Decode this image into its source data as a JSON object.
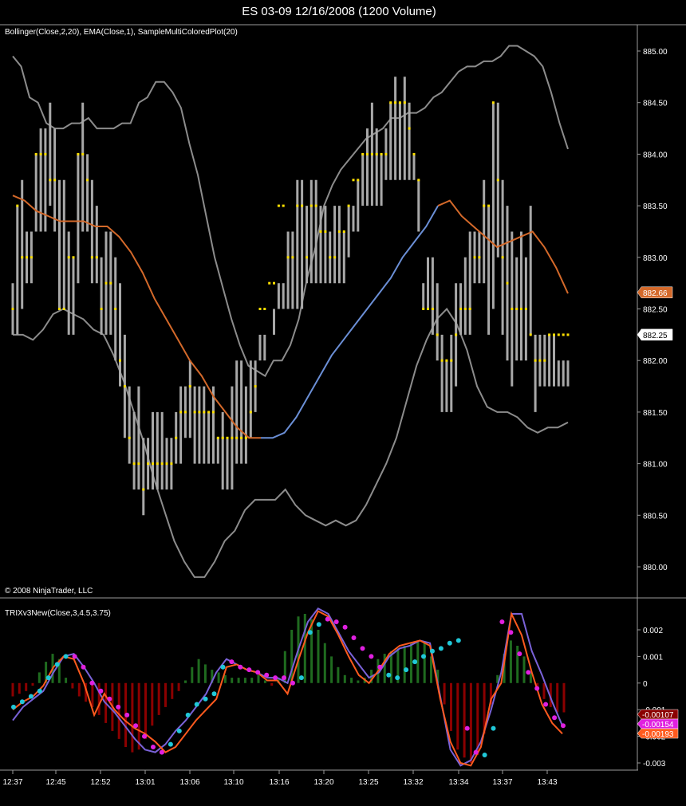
{
  "window": {
    "title": "ES 03-09  12/16/2008 (1200 Volume)"
  },
  "price_panel": {
    "indicator_label": "Bollinger(Close,2,20), EMA(Close,1), SampleMultiColoredPlot(20)",
    "copyright": "© 2008 NinjaTrader, LLC",
    "y_ticks": [
      "885.00",
      "884.50",
      "884.00",
      "883.50",
      "883.00",
      "882.50",
      "882.00",
      "881.50",
      "881.00",
      "880.50",
      "880.00"
    ],
    "last_markers": [
      {
        "text": "882.66",
        "color": "#d4692a",
        "text_color": "#ffffff"
      },
      {
        "text": "882.25",
        "color": "#ffffff",
        "text_color": "#000000"
      }
    ]
  },
  "trix_panel": {
    "indicator_label": "TRIXv3New(Close,3,4.5,3.75)",
    "y_ticks": [
      "0.002",
      "0.001",
      "0",
      "-0.001",
      "-0.002",
      "-0.003"
    ],
    "markers": [
      {
        "text": "-0.00107",
        "color": "#8b0000",
        "text_color": "#ffffff"
      },
      {
        "text": "-0.00154",
        "color": "#e020e0",
        "text_color": "#ffffff"
      },
      {
        "text": "-0.00193",
        "color": "#ff5a1e",
        "text_color": "#ffffff"
      }
    ]
  },
  "x_ticks": [
    "12:37",
    "12:45",
    "12:52",
    "13:01",
    "13:06",
    "13:10",
    "13:16",
    "13:20",
    "13:25",
    "13:32",
    "13:34",
    "13:37",
    "13:43"
  ],
  "colors": {
    "bar": "#a8a8a8",
    "close_tick": "#ffe000",
    "bollinger": "#8c8c8c",
    "ema_down": "#d4692a",
    "ema_up": "#6b8fd6",
    "hist_pos": "#1f6b1f",
    "hist_neg": "#8b0000",
    "trix_line": "#7a62d8",
    "signal_line": "#ff5a1e",
    "dot_up": "#20c8d8",
    "dot_down": "#e020e0"
  },
  "chart_data": [
    {
      "type": "bar",
      "name": "OHLC range bars",
      "x_index": [
        0,
        1,
        2,
        3,
        4,
        5,
        6,
        7,
        8,
        9,
        10,
        11,
        12,
        13,
        14,
        15,
        16,
        17,
        18,
        19,
        20,
        21,
        22,
        23,
        24,
        25,
        26,
        27,
        28,
        29,
        30,
        31,
        32,
        33,
        34,
        35,
        36,
        37,
        38,
        39,
        40,
        41,
        42,
        43,
        44,
        45,
        46,
        47,
        48,
        49,
        50,
        51,
        52,
        53,
        54,
        55,
        56,
        57,
        58,
        59,
        60,
        61,
        62,
        63,
        64,
        65,
        66,
        67,
        68,
        69,
        70,
        71,
        72,
        73,
        74,
        75,
        76,
        77,
        78,
        79,
        80,
        81,
        82,
        83,
        84,
        85,
        86,
        87,
        88,
        89,
        90,
        91,
        92,
        93,
        94,
        95,
        96,
        97,
        98,
        99,
        100,
        101,
        102,
        103,
        104,
        105,
        106,
        107,
        108,
        109,
        110,
        111,
        112,
        113,
        114,
        115,
        116,
        117,
        118,
        119
      ],
      "high": [
        882.75,
        883.5,
        883.75,
        883.25,
        883.25,
        884.0,
        884.25,
        884.25,
        884.5,
        884.25,
        883.75,
        883.75,
        883.25,
        883.0,
        884.0,
        884.5,
        884.0,
        883.75,
        883.5,
        883.0,
        883.25,
        883.25,
        883.0,
        882.75,
        882.25,
        881.75,
        881.5,
        881.75,
        881.25,
        881.25,
        881.5,
        881.5,
        881.5,
        881.25,
        881.25,
        881.5,
        881.75,
        881.75,
        882.0,
        881.75,
        881.75,
        881.75,
        881.5,
        881.75,
        881.25,
        881.5,
        881.25,
        881.75,
        882.0,
        882.0,
        881.75,
        882.0,
        882.0,
        882.0,
        882.0,
        882.25,
        882.25,
        882.75,
        882.75,
        883.25,
        883.25,
        883.75,
        883.75,
        883.5,
        883.75,
        883.75,
        883.5,
        883.5,
        883.25,
        883.5,
        883.5,
        883.25,
        883.5,
        883.25,
        883.75,
        884.0,
        884.25,
        884.5,
        884.25,
        884.0,
        884.25,
        884.5,
        884.75,
        884.5,
        884.75,
        884.5,
        884.0,
        883.75,
        882.75,
        883.0,
        883.0,
        882.75,
        882.25,
        882.0,
        882.25,
        882.75,
        882.75,
        883.0,
        883.25,
        883.25,
        883.25,
        883.75,
        883.5,
        884.5,
        884.5,
        883.75,
        883.5,
        883.25,
        883.0,
        883.25,
        883.0,
        883.5,
        882.25,
        882.25,
        882.25,
        882.25,
        882.25,
        882.0,
        882.0,
        882.0
      ],
      "low": [
        882.25,
        882.25,
        882.5,
        882.75,
        882.75,
        883.25,
        883.25,
        883.25,
        883.5,
        883.25,
        882.5,
        882.5,
        882.25,
        882.25,
        882.75,
        883.25,
        883.25,
        882.75,
        882.75,
        882.25,
        882.25,
        882.25,
        882.0,
        881.75,
        881.25,
        881.0,
        880.75,
        880.75,
        880.5,
        880.75,
        880.75,
        880.75,
        880.75,
        880.75,
        880.75,
        881.0,
        881.0,
        881.25,
        881.25,
        881.0,
        881.0,
        881.0,
        881.0,
        881.0,
        881.0,
        880.75,
        880.75,
        880.75,
        881.0,
        881.0,
        881.0,
        881.25,
        881.5,
        882.25,
        882.25,
        882.25,
        882.5,
        882.5,
        882.5,
        882.5,
        882.5,
        882.5,
        882.5,
        882.75,
        882.75,
        882.75,
        882.75,
        882.75,
        882.75,
        882.75,
        882.75,
        882.75,
        883.0,
        883.5,
        883.25,
        883.5,
        883.5,
        883.5,
        883.5,
        883.5,
        883.75,
        883.75,
        883.75,
        883.75,
        883.75,
        883.75,
        883.75,
        883.25,
        882.5,
        882.5,
        882.25,
        882.0,
        881.5,
        881.5,
        881.5,
        881.75,
        882.25,
        882.25,
        882.25,
        882.75,
        882.75,
        882.75,
        882.25,
        882.5,
        883.0,
        882.25,
        882.0,
        881.75,
        882.0,
        882.0,
        882.0,
        882.25,
        881.5,
        881.75,
        881.75,
        881.75,
        881.75,
        881.75,
        881.75,
        881.75
      ],
      "close": [
        882.5,
        883.5,
        883.0,
        883.0,
        883.0,
        884.0,
        884.0,
        884.0,
        883.75,
        883.75,
        882.5,
        882.5,
        883.0,
        883.0,
        884.0,
        884.0,
        883.75,
        883.0,
        883.0,
        882.5,
        882.75,
        882.75,
        882.5,
        882.0,
        881.75,
        881.25,
        881.0,
        881.0,
        880.75,
        881.0,
        881.0,
        881.0,
        881.0,
        881.0,
        881.0,
        881.25,
        881.5,
        881.5,
        881.75,
        881.5,
        881.5,
        881.5,
        881.5,
        881.5,
        881.25,
        881.25,
        881.25,
        881.25,
        881.25,
        881.25,
        881.25,
        881.5,
        881.75,
        882.5,
        882.5,
        882.75,
        882.75,
        883.5,
        883.5,
        883.0,
        883.0,
        883.5,
        883.5,
        883.0,
        883.5,
        883.5,
        883.25,
        883.25,
        883.0,
        883.0,
        883.25,
        883.25,
        883.5,
        883.75,
        883.75,
        884.0,
        884.0,
        884.0,
        884.0,
        884.0,
        884.0,
        884.5,
        884.5,
        884.5,
        884.5,
        884.25,
        884.0,
        883.75,
        882.5,
        882.5,
        882.5,
        882.25,
        882.0,
        882.0,
        882.0,
        882.25,
        882.5,
        882.5,
        882.5,
        883.0,
        883.0,
        883.5,
        883.5,
        884.5,
        883.75,
        883.0,
        882.75,
        882.5,
        882.5,
        882.5,
        882.5,
        882.25,
        882.0,
        882.0,
        882.0,
        882.25,
        882.25,
        882.25,
        882.25,
        882.25
      ]
    },
    {
      "type": "line",
      "name": "Bollinger Upper",
      "y": [
        884.95,
        884.85,
        884.55,
        884.5,
        884.3,
        884.25,
        884.25,
        884.3,
        884.3,
        884.35,
        884.25,
        884.25,
        884.25,
        884.3,
        884.3,
        884.5,
        884.55,
        884.7,
        884.7,
        884.6,
        884.45,
        884.1,
        883.8,
        883.4,
        883.0,
        882.7,
        882.4,
        882.15,
        881.95,
        881.9,
        881.85,
        882.0,
        882.0,
        882.15,
        882.4,
        882.8,
        883.1,
        883.5,
        883.7,
        883.85,
        883.95,
        884.05,
        884.15,
        884.2,
        884.25,
        884.35,
        884.35,
        884.4,
        884.4,
        884.45,
        884.55,
        884.6,
        884.7,
        884.8,
        884.85,
        884.85,
        884.9,
        884.9,
        884.95,
        885.05,
        885.05,
        885.0,
        884.95,
        884.85,
        884.6,
        884.3,
        884.05
      ],
      "x_step": 1.78
    },
    {
      "type": "line",
      "name": "Bollinger Lower",
      "y": [
        882.25,
        882.25,
        882.2,
        882.3,
        882.45,
        882.5,
        882.45,
        882.4,
        882.3,
        882.25,
        882.05,
        881.8,
        881.5,
        881.2,
        880.85,
        880.55,
        880.25,
        880.05,
        879.9,
        879.9,
        880.05,
        880.25,
        880.35,
        880.55,
        880.65,
        880.65,
        880.65,
        880.75,
        880.6,
        880.5,
        880.45,
        880.4,
        880.45,
        880.4,
        880.45,
        880.6,
        880.8,
        881.0,
        881.25,
        881.6,
        881.95,
        882.2,
        882.4,
        882.5,
        882.35,
        882.1,
        881.75,
        881.55,
        881.5,
        881.5,
        881.45,
        881.35,
        881.3,
        881.35,
        881.35,
        881.4
      ],
      "x_step": 2.14
    },
    {
      "type": "line",
      "name": "EMA (colored)",
      "y": [
        883.6,
        883.55,
        883.45,
        883.4,
        883.35,
        883.35,
        883.35,
        883.3,
        883.3,
        883.2,
        883.05,
        882.85,
        882.6,
        882.4,
        882.2,
        882.0,
        881.85,
        881.65,
        881.5,
        881.35,
        881.25,
        881.25,
        881.25,
        881.3,
        881.45,
        881.65,
        881.85,
        882.05,
        882.2,
        882.35,
        882.5,
        882.65,
        882.8,
        883.0,
        883.15,
        883.3,
        883.5,
        883.55,
        883.4,
        883.3,
        883.2,
        883.1,
        883.15,
        883.2,
        883.25,
        883.1,
        882.9,
        882.65
      ],
      "x_step": 2.5,
      "turning_index": 21
    },
    {
      "type": "bar",
      "name": "TRIX histogram",
      "values": [
        -0.0005,
        -0.0004,
        -0.0003,
        -0.0001,
        0.0004,
        0.0008,
        0.0011,
        0.0009,
        0.0002,
        -0.0002,
        -0.0005,
        -0.0007,
        -0.0009,
        -0.0012,
        -0.0015,
        -0.0018,
        -0.0021,
        -0.0024,
        -0.0026,
        -0.0025,
        -0.0021,
        -0.0016,
        -0.0012,
        -0.0009,
        -0.0006,
        -0.0003,
        0.0001,
        0.0006,
        0.0009,
        0.0007,
        0.0005,
        0.0004,
        0.0003,
        0.0002,
        0.0002,
        0.0002,
        0.0002,
        0.0003,
        0.0001,
        -0.0001,
        0.0002,
        0.0012,
        0.002,
        0.0025,
        0.0026,
        0.0024,
        0.002,
        0.0015,
        0.001,
        0.0006,
        0.0003,
        0.0002,
        0.0001,
        0.0002,
        0.0005,
        0.0009,
        0.0011,
        0.0012,
        0.0013,
        0.0014,
        0.0015,
        0.0016,
        0.0015,
        0.001,
        0.0005,
        -0.0008,
        -0.0018,
        -0.0025,
        -0.0028,
        -0.003,
        -0.0027,
        -0.0019,
        -0.0008,
        0.0003,
        0.0011,
        0.0016,
        0.0014,
        0.001,
        0.0004,
        -0.0002,
        -0.0006,
        -0.0009,
        -0.0011,
        -0.0011
      ],
      "ylim": [
        -0.0033,
        0.0029
      ]
    },
    {
      "type": "line",
      "name": "TRIX",
      "values": [
        -0.0014,
        -0.0009,
        -0.0006,
        -0.0003,
        0.0004,
        0.001,
        0.0011,
        0.0006,
        0.0,
        -0.0007,
        -0.0011,
        -0.0016,
        -0.0021,
        -0.0025,
        -0.0026,
        -0.0023,
        -0.0018,
        -0.0014,
        -0.0009,
        -0.0004,
        0.0004,
        0.0009,
        0.0007,
        0.0005,
        0.0004,
        0.0002,
        0.0002,
        0.0,
        0.0012,
        0.0023,
        0.0028,
        0.0026,
        0.0019,
        0.0012,
        0.0007,
        0.0002,
        0.0004,
        0.001,
        0.0013,
        0.0014,
        0.0016,
        0.0015,
        -0.0005,
        -0.0025,
        -0.0031,
        -0.0029,
        -0.0022,
        -0.001,
        0.0004,
        0.0026,
        0.0026,
        0.0012,
        0.0003,
        -0.0007,
        -0.0016
      ]
    },
    {
      "type": "line",
      "name": "Signal",
      "values": [
        -0.001,
        -0.0007,
        -0.0005,
        -0.0001,
        0.0006,
        0.001,
        0.0009,
        0.0,
        -0.0012,
        -0.0004,
        -0.001,
        -0.0014,
        -0.0017,
        -0.0019,
        -0.0022,
        -0.0026,
        -0.0024,
        -0.0019,
        -0.0014,
        -0.001,
        -0.0006,
        0.0006,
        0.0007,
        0.0005,
        0.0004,
        0.0001,
        0.0001,
        -0.0004,
        0.0008,
        0.0019,
        0.0027,
        0.0025,
        0.0018,
        0.001,
        0.0003,
        0.0,
        0.0005,
        0.0011,
        0.0014,
        0.0015,
        0.0016,
        0.0014,
        -0.0006,
        -0.0022,
        -0.003,
        -0.0031,
        -0.0024,
        -0.0006,
        0.0,
        0.0026,
        0.0018,
        0.0004,
        -0.0008,
        -0.0015,
        -0.0019
      ]
    },
    {
      "type": "scatter",
      "name": "TRIX dots",
      "values": [
        -0.0009,
        -0.0007,
        -0.0005,
        -0.0003,
        0.0002,
        0.0007,
        0.001,
        0.001,
        0.0006,
        0.0,
        -0.0003,
        -0.0006,
        -0.0009,
        -0.0012,
        -0.0016,
        -0.002,
        -0.0024,
        -0.0026,
        -0.0023,
        -0.0018,
        -0.0012,
        -0.0008,
        -0.0006,
        -0.0004,
        0.0006,
        0.0008,
        0.0006,
        0.0005,
        0.0004,
        0.0003,
        0.0002,
        0.0002,
        0.0,
        0.0002,
        0.0019,
        0.0022,
        0.0024,
        0.0023,
        0.0021,
        0.0017,
        0.0013,
        0.001,
        0.0006,
        0.0003,
        0.0002,
        0.0005,
        0.0008,
        0.001,
        0.0012,
        0.0013,
        0.0015,
        0.0016,
        -0.0017,
        -0.0026,
        -0.0027,
        -0.0017,
        0.0023,
        0.0019,
        0.0011,
        0.0004,
        -0.0002,
        -0.0008,
        -0.0013,
        -0.0016
      ],
      "up": [
        true,
        true,
        true,
        true,
        true,
        true,
        true,
        false,
        false,
        false,
        false,
        false,
        false,
        false,
        false,
        false,
        false,
        false,
        true,
        true,
        true,
        true,
        true,
        true,
        true,
        false,
        false,
        false,
        false,
        false,
        false,
        false,
        false,
        true,
        true,
        true,
        false,
        false,
        false,
        false,
        false,
        false,
        false,
        true,
        true,
        true,
        true,
        true,
        true,
        true,
        true,
        true,
        false,
        false,
        true,
        true,
        false,
        false,
        false,
        false,
        false,
        false,
        false,
        false
      ]
    }
  ]
}
